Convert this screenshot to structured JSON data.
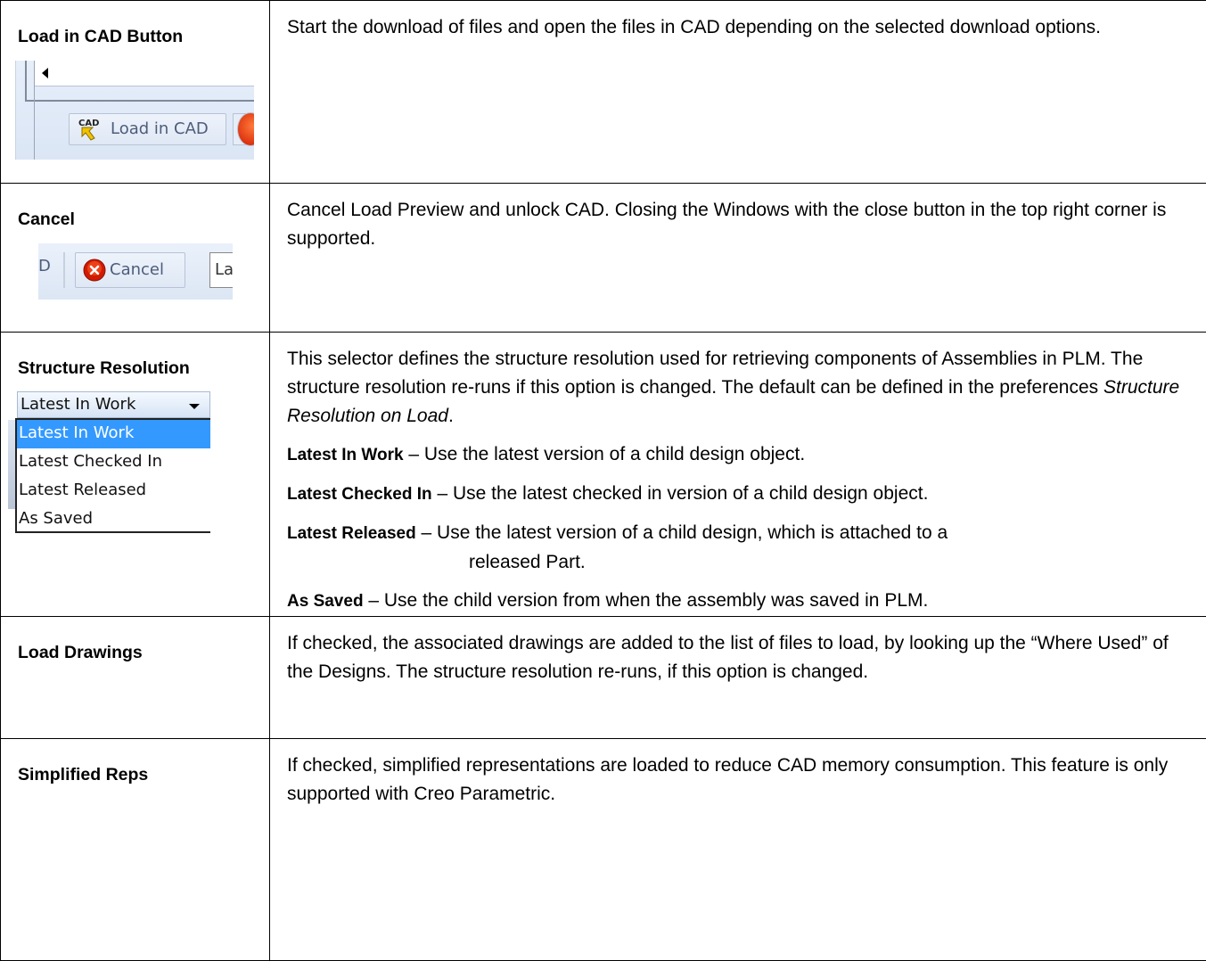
{
  "rows": [
    {
      "label": "Load in CAD Button",
      "shot": {
        "button_label": "Load in CAD"
      },
      "description": "Start the download of files and open the files in CAD depending on the selected download options."
    },
    {
      "label": "Cancel",
      "shot": {
        "left_fragment": "D",
        "button_label": "Cancel",
        "right_fragment": "La"
      },
      "description": "Cancel Load Preview and unlock CAD. Closing the Windows with the close button in the top right corner is supported."
    },
    {
      "label": "Structure Resolution",
      "shot": {
        "selected_value": "Latest In Work",
        "options": [
          "Latest In Work",
          "Latest Checked In",
          "Latest Released",
          "As Saved"
        ]
      },
      "description_intro": "This selector defines the structure resolution used for retrieving components of Assemblies in PLM. The structure resolution re-runs if this option is changed. The default can be defined in the preferences ",
      "description_pref": "Structure Resolution on Load",
      "description_end": ".",
      "options_explained": [
        {
          "term": "Latest In Work",
          "text": " – Use the latest version of a child design object."
        },
        {
          "term": "Latest Checked In",
          "text": " – Use the latest checked in version of a child design object."
        },
        {
          "term": "Latest Released",
          "text": " – Use the latest version of a child design, which is attached to a",
          "continuation": "released Part."
        },
        {
          "term": "As Saved",
          "text": " – Use the child version from when the assembly was saved in PLM."
        }
      ]
    },
    {
      "label": "Load Drawings",
      "description": "If checked, the associated drawings are added to the list of files to load, by looking up the “Where Used” of the Designs. The structure resolution re-runs, if this option is changed."
    },
    {
      "label": "Simplified Reps",
      "description": "If checked, simplified representations are loaded to reduce CAD memory consumption. This feature is only supported with Creo Parametric."
    }
  ],
  "colors": {
    "selected_option_bg": "#3399ff",
    "cancel_icon": "#d11a00",
    "button_text": "#4d5d7a"
  },
  "icons": [
    "cad-load-icon",
    "cancel-x-icon",
    "combo-arrow-icon",
    "scroll-left-arrow-icon"
  ]
}
